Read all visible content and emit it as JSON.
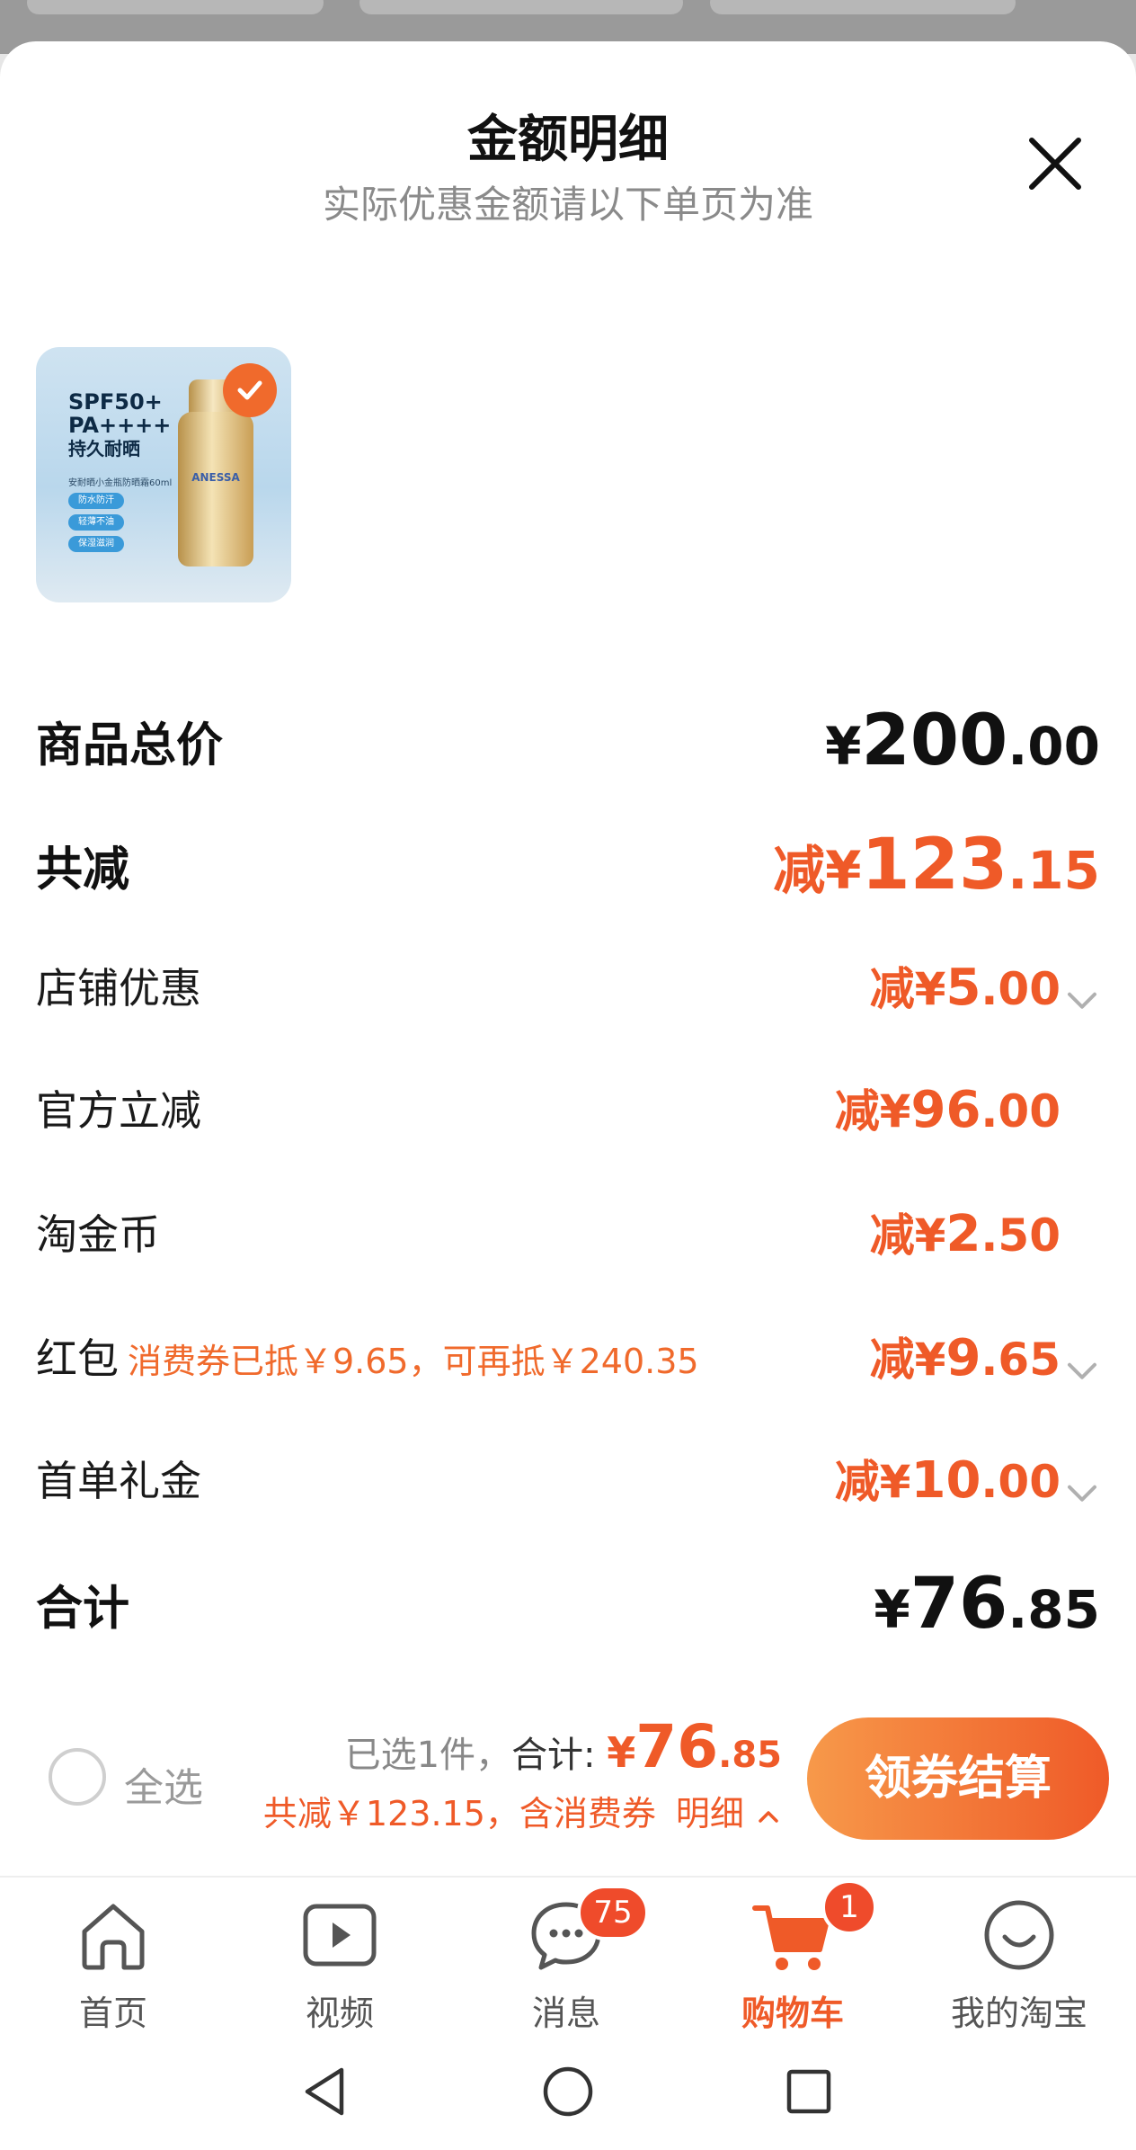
{
  "header": {
    "title": "金额明细",
    "subtitle": "实际优惠金额请以下单页为准"
  },
  "product": {
    "image_text": {
      "line1": "SPF50+",
      "line2": "PA++++",
      "line3": "持久耐晒",
      "line4": "安耐晒小金瓶防晒霜60ml",
      "tags": [
        "防水防汗",
        "轻薄不油",
        "保湿滋润"
      ],
      "brand": "ANESSA"
    }
  },
  "rows": {
    "subtotal": {
      "label": "商品总价",
      "prefix": "¥",
      "int": "200",
      "dec": ".00"
    },
    "total_discount": {
      "label": "共减",
      "prefix": "减¥",
      "int": "123",
      "dec": ".15"
    },
    "shop_discount": {
      "label": "店铺优惠",
      "prefix": "减¥",
      "int": "5",
      "dec": ".00"
    },
    "official_discount": {
      "label": "官方立减",
      "prefix": "减¥",
      "int": "96",
      "dec": ".00"
    },
    "coins": {
      "label": "淘金币",
      "prefix": "减¥",
      "int": "2",
      "dec": ".50"
    },
    "red_packet": {
      "label": "红包",
      "note": "消费券已抵￥9.65，可再抵￥240.35",
      "prefix": "减¥",
      "int": "9",
      "dec": ".65"
    },
    "first_order": {
      "label": "首单礼金",
      "prefix": "减¥",
      "int": "10",
      "dec": ".00"
    },
    "total": {
      "label": "合计",
      "prefix": "¥",
      "int": "76",
      "dec": ".85"
    }
  },
  "checkout": {
    "select_all": "全选",
    "selected_text": "已选1件，",
    "sum_label": "合计:",
    "sum_prefix": "¥",
    "sum_int": "76",
    "sum_dec": ".85",
    "discount_text": "共减￥123.15，含消费券",
    "detail_label": "明细",
    "button_label": "领券结算"
  },
  "tabbar": {
    "home": "首页",
    "video": "视频",
    "messages": "消息",
    "messages_badge": "75",
    "cart": "购物车",
    "cart_badge": "1",
    "profile": "我的淘宝"
  },
  "colors": {
    "accent": "#ef5a28",
    "accent_light": "#f7994a",
    "text": "#111111",
    "muted": "#8a8a8a"
  }
}
